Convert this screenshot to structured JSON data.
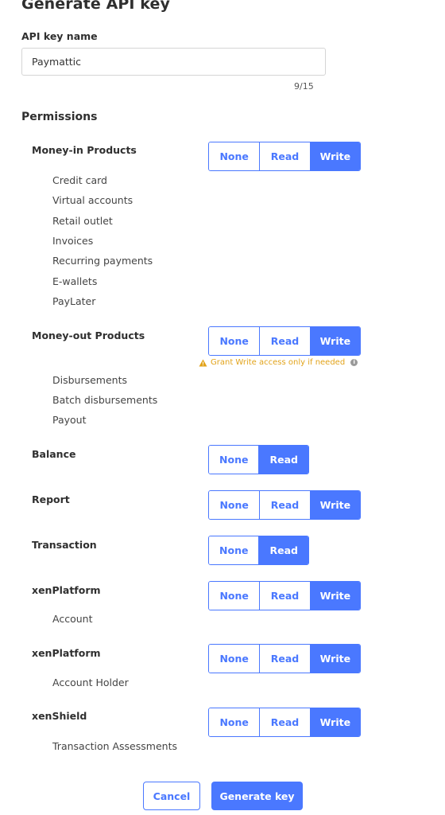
{
  "page": {
    "title": "Generate API key"
  },
  "api_key_field": {
    "label": "API key name",
    "value": "Paymattic",
    "counter": "9/15"
  },
  "permissions": {
    "title": "Permissions",
    "options": [
      "None",
      "Read",
      "Write"
    ],
    "groups": [
      {
        "label": "Money-in Products",
        "options": [
          "None",
          "Read",
          "Write"
        ],
        "selected": "Write",
        "items": [
          "Credit card",
          "Virtual accounts",
          "Retail outlet",
          "Invoices",
          "Recurring payments",
          "E-wallets",
          "PayLater"
        ]
      },
      {
        "label": "Money-out Products",
        "options": [
          "None",
          "Read",
          "Write"
        ],
        "selected": "Write",
        "warning": "Grant Write access only if needed",
        "items": [
          "Disbursements",
          "Batch disbursements",
          "Payout"
        ]
      },
      {
        "label": "Balance",
        "options": [
          "None",
          "Read"
        ],
        "selected": "Read",
        "items": []
      },
      {
        "label": "Report",
        "options": [
          "None",
          "Read",
          "Write"
        ],
        "selected": "Write",
        "items": []
      },
      {
        "label": "Transaction",
        "options": [
          "None",
          "Read"
        ],
        "selected": "Read",
        "items": []
      },
      {
        "label": "xenPlatform",
        "options": [
          "None",
          "Read",
          "Write"
        ],
        "selected": "Write",
        "items": [
          "Account"
        ]
      },
      {
        "label": "xenPlatform",
        "options": [
          "None",
          "Read",
          "Write"
        ],
        "selected": "Write",
        "items": [
          "Account Holder"
        ]
      },
      {
        "label": "xenShield",
        "options": [
          "None",
          "Read",
          "Write"
        ],
        "selected": "Write",
        "items": [
          "Transaction Assessments"
        ]
      }
    ]
  },
  "footer": {
    "cancel_label": "Cancel",
    "generate_label": "Generate key"
  },
  "colors": {
    "accent": "#4a78ff",
    "warning": "#e2a31a"
  }
}
